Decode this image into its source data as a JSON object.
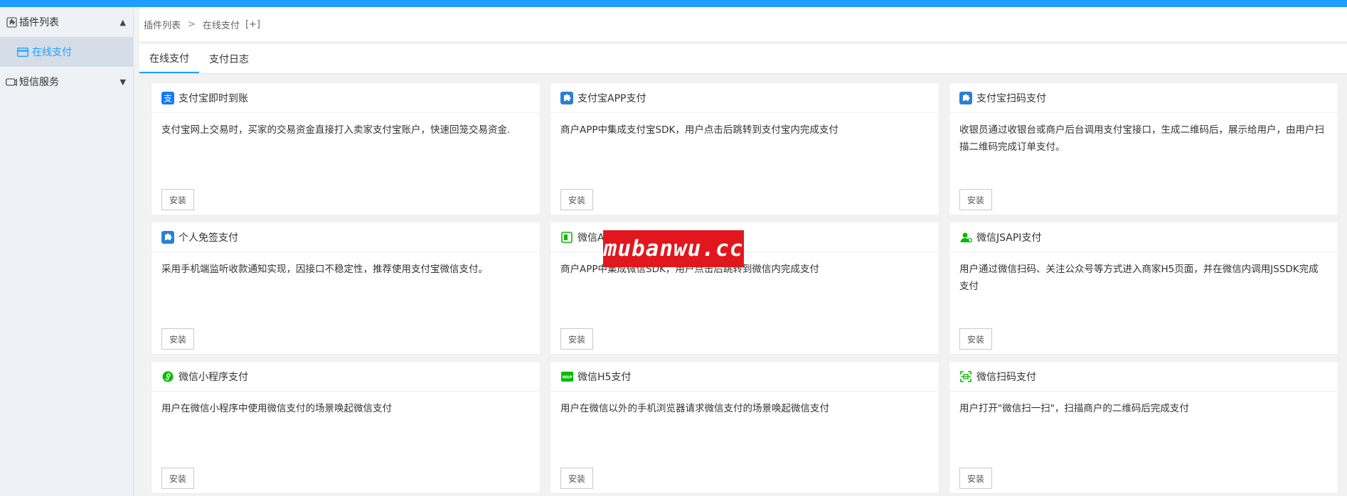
{
  "sidebar": {
    "groups": [
      {
        "label": "插件列表",
        "expanded": true,
        "children": [
          {
            "label": "在线支付",
            "active": true
          }
        ]
      },
      {
        "label": "短信服务",
        "expanded": false
      }
    ]
  },
  "breadcrumb": {
    "items": [
      "插件列表",
      "在线支付"
    ],
    "separator": ">",
    "add_label": "[+]"
  },
  "tabs": [
    {
      "label": "在线支付",
      "active": true
    },
    {
      "label": "支付日志",
      "active": false
    }
  ],
  "cards": [
    {
      "title": "支付宝即时到账",
      "icon": "alipay-icon",
      "desc": "支付宝网上交易时，买家的交易资金直接打入卖家支付宝账户，快速回笼交易资金.",
      "button": "安装"
    },
    {
      "title": "支付宝APP支付",
      "icon": "puzzle-icon",
      "desc": "商户APP中集成支付宝SDK，用户点击后跳转到支付宝内完成支付",
      "button": "安装"
    },
    {
      "title": "支付宝扫码支付",
      "icon": "puzzle-icon",
      "desc": "收银员通过收银台或商户后台调用支付宝接口，生成二维码后，展示给用户，由用户扫描二维码完成订单支付。",
      "button": "安装"
    },
    {
      "title": "个人免签支付",
      "icon": "puzzle-icon",
      "desc": "采用手机端监听收款通知实现，因接口不稳定性，推荐使用支付宝微信支付。",
      "button": "安装"
    },
    {
      "title": "微信APP支付",
      "icon": "wechat-app-icon",
      "desc": "商户APP中集成微信SDK，用户点击后跳转到微信内完成支付",
      "button": "安装"
    },
    {
      "title": "微信JSAPI支付",
      "icon": "user-icon",
      "desc": "用户通过微信扫码、关注公众号等方式进入商家H5页面，并在微信内调用JSSDK完成支付",
      "button": "安装"
    },
    {
      "title": "微信小程序支付",
      "icon": "miniprogram-icon",
      "desc": "用户在微信小程序中使用微信支付的场景唤起微信支付",
      "button": "安装"
    },
    {
      "title": "微信H5支付",
      "icon": "wap-icon",
      "desc": "用户在微信以外的手机浏览器请求微信支付的场景唤起微信支付",
      "button": "安装"
    },
    {
      "title": "微信扫码支付",
      "icon": "scan-icon",
      "desc": "用户打开\"微信扫一扫\"，扫描商户的二维码后完成支付",
      "button": "安装"
    }
  ],
  "watermark": "mubanwu.cc",
  "colors": {
    "accent": "#1e9fff",
    "wechat": "#09bb07",
    "alipay": "#1677ff",
    "watermark_bg": "#e1171e"
  }
}
